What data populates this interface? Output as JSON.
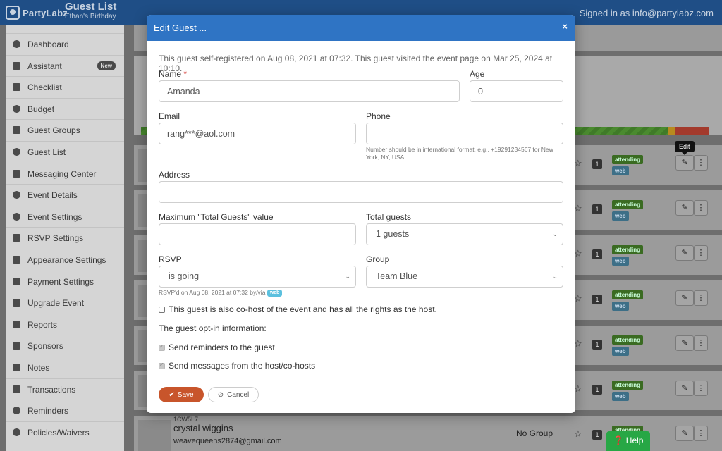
{
  "app": {
    "brand": "PartyLabz",
    "title": "Guest List",
    "subtitle": "Ethan's Birthday",
    "signed_in": "Signed in as info@partylabz.com"
  },
  "sidebar": {
    "items": [
      {
        "label": "Dashboard",
        "icon": "clock-icon"
      },
      {
        "label": "Assistant",
        "icon": "bolt-icon",
        "badge": "New"
      },
      {
        "label": "Checklist",
        "icon": "list-icon"
      },
      {
        "label": "Budget",
        "icon": "piggy-bank-icon"
      },
      {
        "label": "Guest Groups",
        "icon": "book-icon"
      },
      {
        "label": "Guest List",
        "icon": "user-icon"
      },
      {
        "label": "Messaging Center",
        "icon": "envelope-icon"
      },
      {
        "label": "Event Details",
        "icon": "info-icon"
      },
      {
        "label": "Event Settings",
        "icon": "cog-icon"
      },
      {
        "label": "RSVP Settings",
        "icon": "wrench-icon"
      },
      {
        "label": "Appearance Settings",
        "icon": "image-icon"
      },
      {
        "label": "Payment Settings",
        "icon": "credit-card-icon"
      },
      {
        "label": "Upgrade Event",
        "icon": "cart-icon"
      },
      {
        "label": "Reports",
        "icon": "bar-chart-icon"
      },
      {
        "label": "Sponsors",
        "icon": "megaphone-icon"
      },
      {
        "label": "Notes",
        "icon": "edit-icon"
      },
      {
        "label": "Transactions",
        "icon": "receipt-icon"
      },
      {
        "label": "Reminders",
        "icon": "clock-icon"
      },
      {
        "label": "Policies/Waivers",
        "icon": "puzzle-icon"
      }
    ]
  },
  "guest_rows": {
    "status": "attending",
    "source": "web",
    "count": "1",
    "last": {
      "code": "1CW5L7",
      "name": "crystal wiggins",
      "email": "weavequeens2874@gmail.com",
      "group": "No Group"
    }
  },
  "tooltip": "Edit",
  "help": "Help",
  "modal": {
    "title": "Edit Guest ...",
    "close": "×",
    "info": "This guest self-registered on Aug 08, 2021 at 07:32. This guest visited the event page on Mar 25, 2024 at 10:10.",
    "fields": {
      "name_label": "Name",
      "name_required": "*",
      "name_value": "Amanda",
      "age_label": "Age",
      "age_value": "0",
      "email_label": "Email",
      "email_value": "rang***@aol.com",
      "phone_label": "Phone",
      "phone_value": "",
      "phone_hint": "Number should be in international format, e.g., +19291234567 for New York, NY, USA",
      "address_label": "Address",
      "address_value": "",
      "max_total_label": "Maximum \"Total Guests\" value",
      "max_total_value": "",
      "total_label": "Total guests",
      "total_value": "1 guests",
      "rsvp_label": "RSVP",
      "rsvp_value": "is going",
      "rsvp_hint": "RSVP'd on Aug 08, 2021 at 07:32 by/via",
      "rsvp_hint_tag": "web",
      "group_label": "Group",
      "group_value": "Team Blue"
    },
    "cohost_label": "This guest is also co-host of the event and has all the rights as the host.",
    "optin_heading": "The guest opt-in information:",
    "optin_reminders": "Send reminders to the guest",
    "optin_messages": "Send messages from the host/co-hosts",
    "save": "Save",
    "cancel": "Cancel"
  },
  "colors": {
    "header": "#2f74c4",
    "save": "#c8552b",
    "help": "#27a745"
  }
}
